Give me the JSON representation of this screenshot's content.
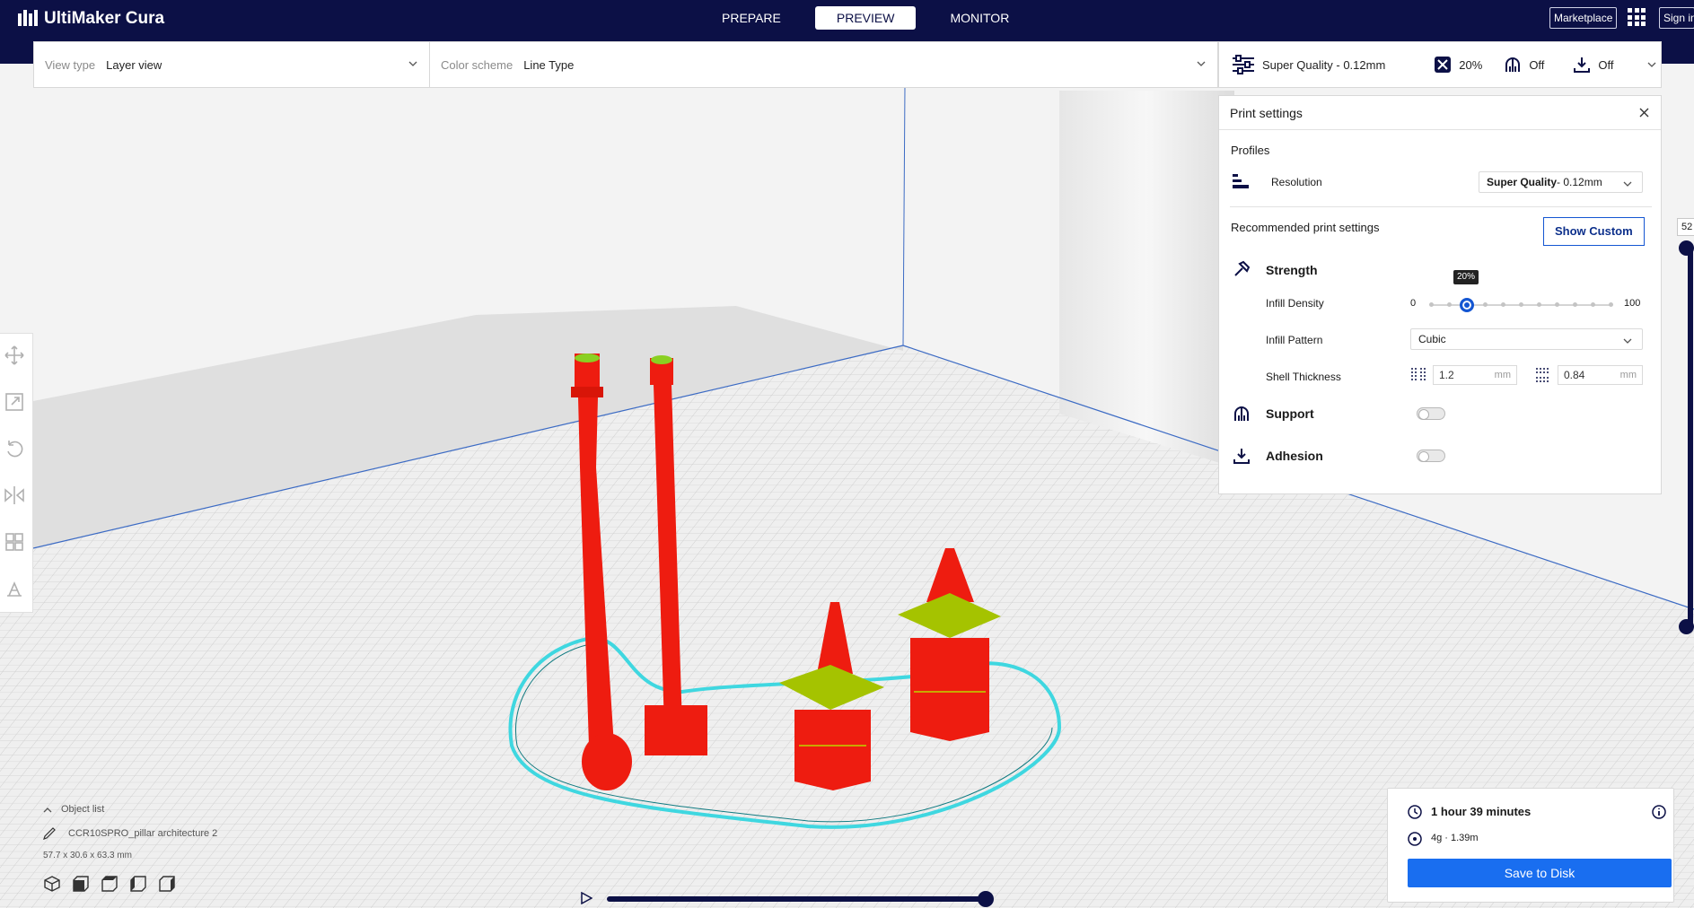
{
  "app": {
    "title": "UltiMaker Cura"
  },
  "header": {
    "tabs": [
      {
        "label": "PREPARE",
        "active": false
      },
      {
        "label": "PREVIEW",
        "active": true
      },
      {
        "label": "MONITOR",
        "active": false
      }
    ],
    "marketplace": "Marketplace",
    "sign_in": "Sign in"
  },
  "viewbar": {
    "view_type_label": "View type",
    "view_type_value": "Layer view",
    "color_scheme_label": "Color scheme",
    "color_scheme_value": "Line Type"
  },
  "print_summary": {
    "profile": "Super Quality - 0.12mm",
    "infill": "20%",
    "support": "Off",
    "adhesion": "Off"
  },
  "print_settings": {
    "title": "Print settings",
    "profiles_label": "Profiles",
    "resolution_label": "Resolution",
    "resolution_value_bold": "Super Quality",
    "resolution_value_rest": " - 0.12mm",
    "recommended_label": "Recommended print settings",
    "show_custom": "Show Custom",
    "strength_label": "Strength",
    "infill_density_label": "Infill Density",
    "infill_min": "0",
    "infill_max": "100",
    "infill_value_label": "20%",
    "infill_value": 20,
    "infill_pattern_label": "Infill Pattern",
    "infill_pattern_value": "Cubic",
    "shell_thickness_label": "Shell Thickness",
    "wall_thickness": "1.2",
    "top_bottom_thickness": "0.84",
    "unit": "mm",
    "support_label": "Support",
    "support_enabled": false,
    "adhesion_label": "Adhesion",
    "adhesion_enabled": false
  },
  "layer_slider": {
    "value": "52"
  },
  "object_list": {
    "label": "Object list",
    "name": "CCR10SPRO_pillar architecture 2",
    "dimensions": "57.7 x 30.6 x 63.3 mm"
  },
  "estimate": {
    "time": "1 hour 39 minutes",
    "material": "4g · 1.39m",
    "save_label": "Save to Disk"
  },
  "colors": {
    "header_bg": "#0c1046",
    "accent": "#196ef0",
    "model_red": "#ee1c10",
    "travel_cyan": "#3fd7e0"
  }
}
